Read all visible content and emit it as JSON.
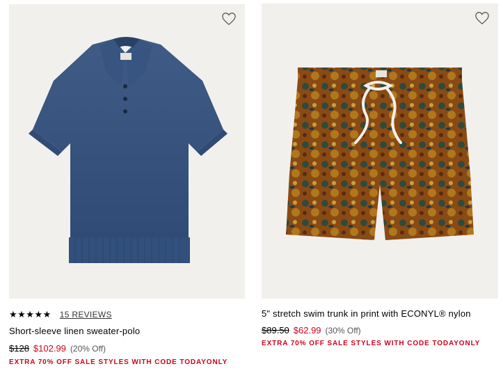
{
  "products": [
    {
      "rating_stars": "★★★★★",
      "reviews_label": "15 REVIEWS",
      "name": "Short-sleeve linen sweater-polo",
      "original_price": "$128",
      "sale_price": "$102.99",
      "discount": "(20% Off)",
      "promo": "EXTRA 70% OFF SALE STYLES WITH CODE TODAYONLY",
      "image_bg": "#f2f0ed"
    },
    {
      "name": "5\" stretch swim trunk in print with ECONYL® nylon",
      "original_price": "$89.50",
      "sale_price": "$62.99",
      "discount": "(30% Off)",
      "promo": "EXTRA 70% OFF SALE STYLES WITH CODE TODAYONLY",
      "image_bg": "#f2f0ed"
    }
  ],
  "colors": {
    "sale_red": "#d0021b",
    "image_bg": "#f2f0ed"
  },
  "icons": {
    "wishlist": "heart-outline-icon"
  }
}
